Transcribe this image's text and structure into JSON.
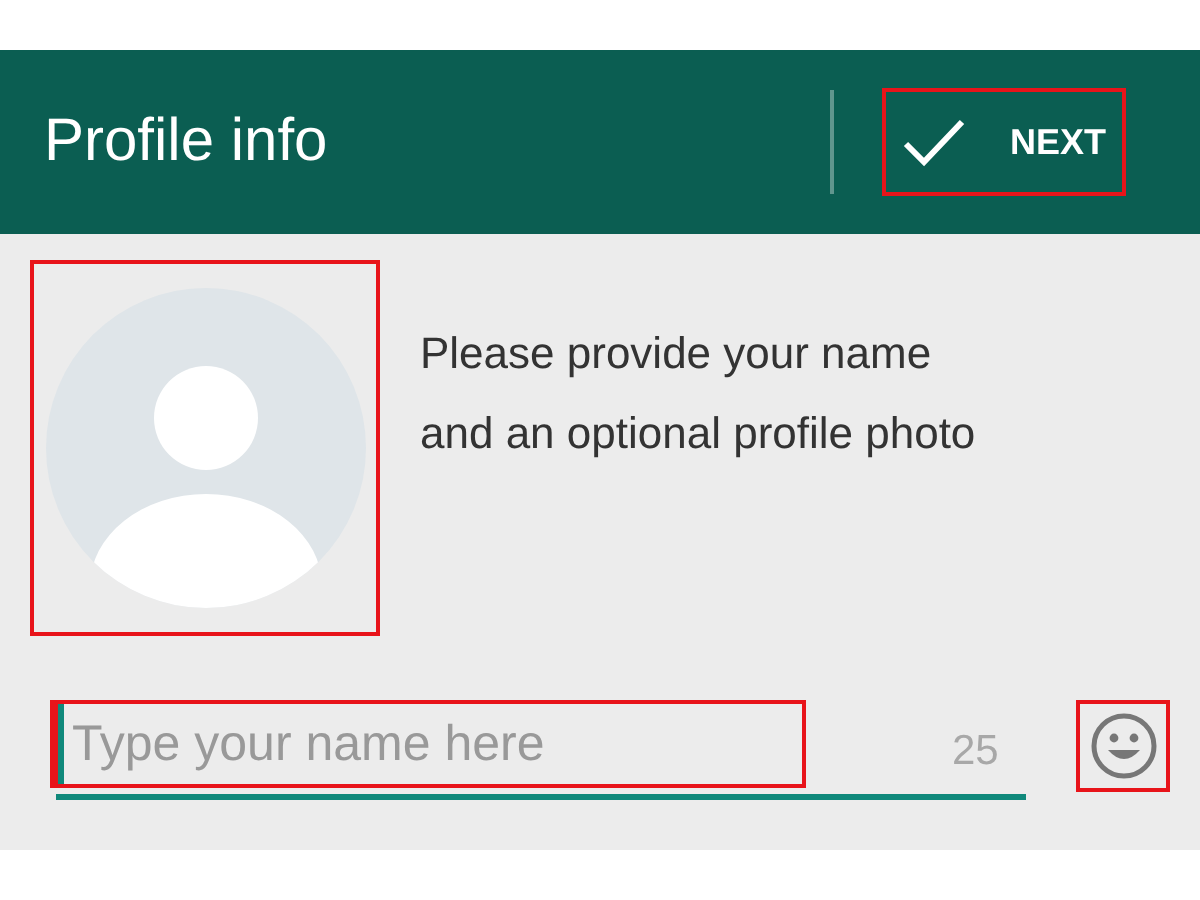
{
  "header": {
    "title": "Profile info",
    "action": {
      "label": "NEXT"
    }
  },
  "intro": [
    "Please provide your name",
    "and an optional profile photo"
  ],
  "name_field": {
    "placeholder": "Type your name here",
    "counter": "25"
  }
}
